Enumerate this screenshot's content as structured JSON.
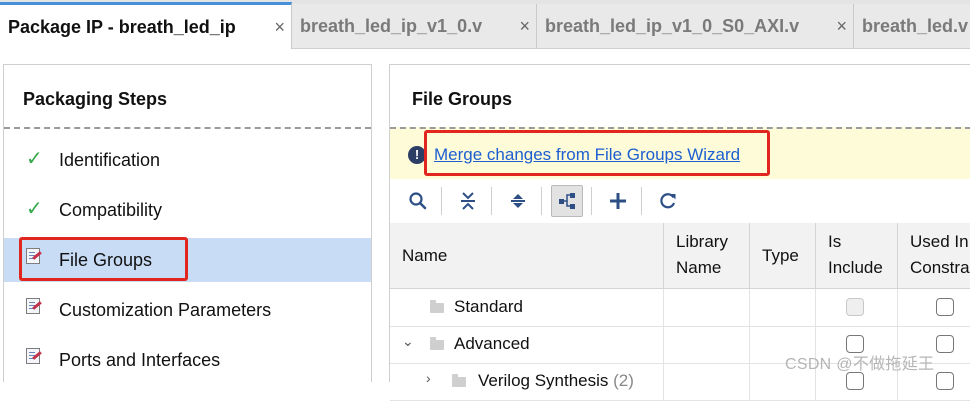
{
  "tabs": [
    {
      "label": "Package IP - breath_led_ip",
      "close": "×",
      "active": true
    },
    {
      "label": "breath_led_ip_v1_0.v",
      "close": "×",
      "active": false
    },
    {
      "label": "breath_led_ip_v1_0_S0_AXI.v",
      "close": "×",
      "active": false
    },
    {
      "label": "breath_led.v",
      "close": "",
      "active": false
    }
  ],
  "left_panel": {
    "title": "Packaging Steps",
    "steps": [
      {
        "label": "Identification",
        "icon": "check-icon"
      },
      {
        "label": "Compatibility",
        "icon": "check-icon"
      },
      {
        "label": "File Groups",
        "icon": "edit-document-icon",
        "selected": true
      },
      {
        "label": "Customization Parameters",
        "icon": "edit-document-icon"
      },
      {
        "label": "Ports and Interfaces",
        "icon": "edit-document-icon"
      }
    ]
  },
  "right_panel": {
    "title": "File Groups",
    "warning_icon": "!",
    "merge_link": "Merge changes from File Groups Wizard",
    "toolbar": [
      "search-icon",
      "collapse-all-icon",
      "expand-all-icon",
      "hierarchy-icon",
      "add-icon",
      "refresh-icon"
    ],
    "columns": {
      "name": "Name",
      "library_1": "Library",
      "library_2": "Name",
      "type": "Type",
      "is_1": "Is",
      "is_2": "Include",
      "used_1": "Used In",
      "used_2": "Constraints"
    },
    "rows": [
      {
        "name": "Standard",
        "expander": "",
        "count": ""
      },
      {
        "name": "Advanced",
        "expander": "⌄",
        "count": ""
      },
      {
        "name": "Verilog Synthesis",
        "expander": "›",
        "count": "(2)"
      }
    ]
  },
  "watermark": "CSDN @不做拖延王",
  "colors": {
    "selection": "#c9dcf6",
    "highlight_box": "#e0261f",
    "link": "#1d5fd1",
    "warning_bar": "#fdfbd8"
  }
}
